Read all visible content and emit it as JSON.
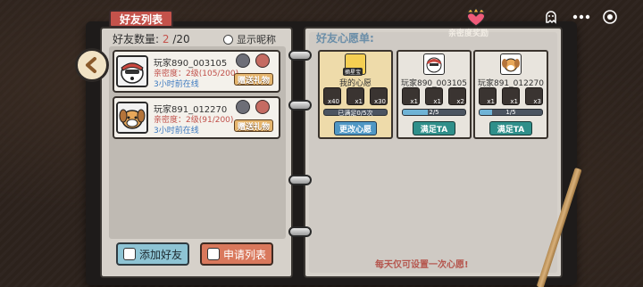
{
  "left_page": {
    "tab_title": "好友列表",
    "friend_count_label": "好友数量:",
    "friend_count_current": "2",
    "friend_count_sep_max": "/20",
    "show_remark_label": "显示昵称",
    "friends": [
      {
        "name": "玩家890_003105",
        "intimacy": "亲密度：2级(105/200)",
        "online": "3小时前在线",
        "gift_label": "赠送礼物"
      },
      {
        "name": "玩家891_012270",
        "intimacy": "亲密度：2级(91/200)",
        "online": "3小时前在线",
        "gift_label": "赠送礼物"
      }
    ],
    "add_friend_label": "添加好友",
    "request_list_label": "申请列表"
  },
  "right_page": {
    "title": "好友心愿单:",
    "reward_label": "亲密度奖励",
    "mine": {
      "badge": "摘星宝",
      "name": "我的心愿",
      "items": [
        {
          "qty": "x40"
        },
        {
          "qty": "x1"
        },
        {
          "qty": "x30"
        }
      ],
      "progress_text": "已满足0/5次",
      "progress": 0,
      "button": "更改心愿"
    },
    "wishes": [
      {
        "name": "玩家890_003105",
        "items": [
          {
            "qty": "x1"
          },
          {
            "qty": "x1"
          },
          {
            "qty": "x2"
          }
        ],
        "progress_text": "2/5",
        "progress": 0.4,
        "button": "满足TA"
      },
      {
        "name": "玩家891_012270",
        "items": [
          {
            "qty": "x1"
          },
          {
            "qty": "x1"
          },
          {
            "qty": "x3"
          }
        ],
        "progress_text": "1/5",
        "progress": 0.2,
        "button": "满足TA"
      }
    ],
    "notice": "每天仅可设置一次心愿!"
  },
  "colors": {
    "accent_red": "#c4524b",
    "link_blue": "#3d7ac0",
    "teal_button": "#2f8f8a",
    "gold_button": "#e5b56d"
  }
}
